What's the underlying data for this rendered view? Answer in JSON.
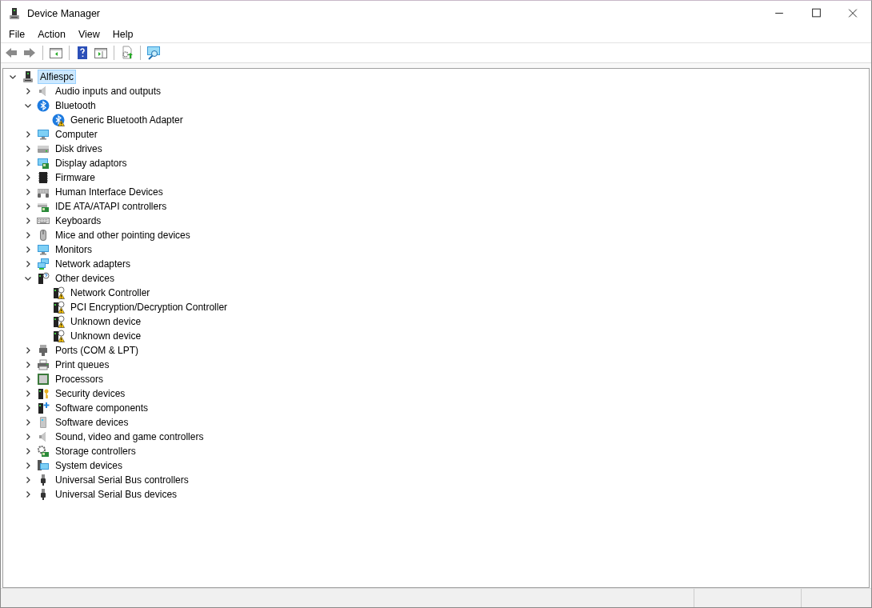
{
  "window": {
    "title": "Device Manager"
  },
  "menu": [
    "File",
    "Action",
    "View",
    "Help"
  ],
  "tree": {
    "label": "Alfiespc",
    "kind": "pc",
    "expanded": true,
    "selected": true,
    "warning": false,
    "children": [
      {
        "label": "Audio inputs and outputs",
        "kind": "speaker",
        "expanded": false,
        "selected": false,
        "warning": false
      },
      {
        "label": "Bluetooth",
        "kind": "bluetooth",
        "expanded": true,
        "selected": false,
        "warning": false,
        "children": [
          {
            "label": "Generic Bluetooth Adapter",
            "kind": "bluetooth",
            "selected": false,
            "warning": true
          }
        ]
      },
      {
        "label": "Computer",
        "kind": "monitor",
        "expanded": false,
        "selected": false,
        "warning": false
      },
      {
        "label": "Disk drives",
        "kind": "drive",
        "expanded": false,
        "selected": false,
        "warning": false
      },
      {
        "label": "Display adaptors",
        "kind": "adapter",
        "expanded": false,
        "selected": false,
        "warning": false
      },
      {
        "label": "Firmware",
        "kind": "chip",
        "expanded": false,
        "selected": false,
        "warning": false
      },
      {
        "label": "Human Interface Devices",
        "kind": "hid",
        "expanded": false,
        "selected": false,
        "warning": false
      },
      {
        "label": "IDE ATA/ATAPI controllers",
        "kind": "card",
        "expanded": false,
        "selected": false,
        "warning": false
      },
      {
        "label": "Keyboards",
        "kind": "keyboard",
        "expanded": false,
        "selected": false,
        "warning": false
      },
      {
        "label": "Mice and other pointing devices",
        "kind": "mouse",
        "expanded": false,
        "selected": false,
        "warning": false
      },
      {
        "label": "Monitors",
        "kind": "monitor",
        "expanded": false,
        "selected": false,
        "warning": false
      },
      {
        "label": "Network adapters",
        "kind": "network",
        "expanded": false,
        "selected": false,
        "warning": false
      },
      {
        "label": "Other devices",
        "kind": "other",
        "expanded": true,
        "selected": false,
        "warning": false,
        "children": [
          {
            "label": "Network Controller",
            "kind": "tower",
            "selected": false,
            "warning": true
          },
          {
            "label": "PCI Encryption/Decryption Controller",
            "kind": "tower",
            "selected": false,
            "warning": true
          },
          {
            "label": "Unknown device",
            "kind": "tower",
            "selected": false,
            "warning": true
          },
          {
            "label": "Unknown device",
            "kind": "tower",
            "selected": false,
            "warning": true
          }
        ]
      },
      {
        "label": "Ports (COM & LPT)",
        "kind": "port",
        "expanded": false,
        "selected": false,
        "warning": false
      },
      {
        "label": "Print queues",
        "kind": "printer",
        "expanded": false,
        "selected": false,
        "warning": false
      },
      {
        "label": "Processors",
        "kind": "processor",
        "expanded": false,
        "selected": false,
        "warning": false
      },
      {
        "label": "Security devices",
        "kind": "security",
        "expanded": false,
        "selected": false,
        "warning": false
      },
      {
        "label": "Software components",
        "kind": "component",
        "expanded": false,
        "selected": false,
        "warning": false
      },
      {
        "label": "Software devices",
        "kind": "software",
        "expanded": false,
        "selected": false,
        "warning": false
      },
      {
        "label": "Sound, video and game controllers",
        "kind": "speaker",
        "expanded": false,
        "selected": false,
        "warning": false
      },
      {
        "label": "Storage controllers",
        "kind": "storage",
        "expanded": false,
        "selected": false,
        "warning": false
      },
      {
        "label": "System devices",
        "kind": "system",
        "expanded": false,
        "selected": false,
        "warning": false
      },
      {
        "label": "Universal Serial Bus controllers",
        "kind": "usb",
        "expanded": false,
        "selected": false,
        "warning": false
      },
      {
        "label": "Universal Serial Bus devices",
        "kind": "usb",
        "expanded": false,
        "selected": false,
        "warning": false
      }
    ]
  }
}
